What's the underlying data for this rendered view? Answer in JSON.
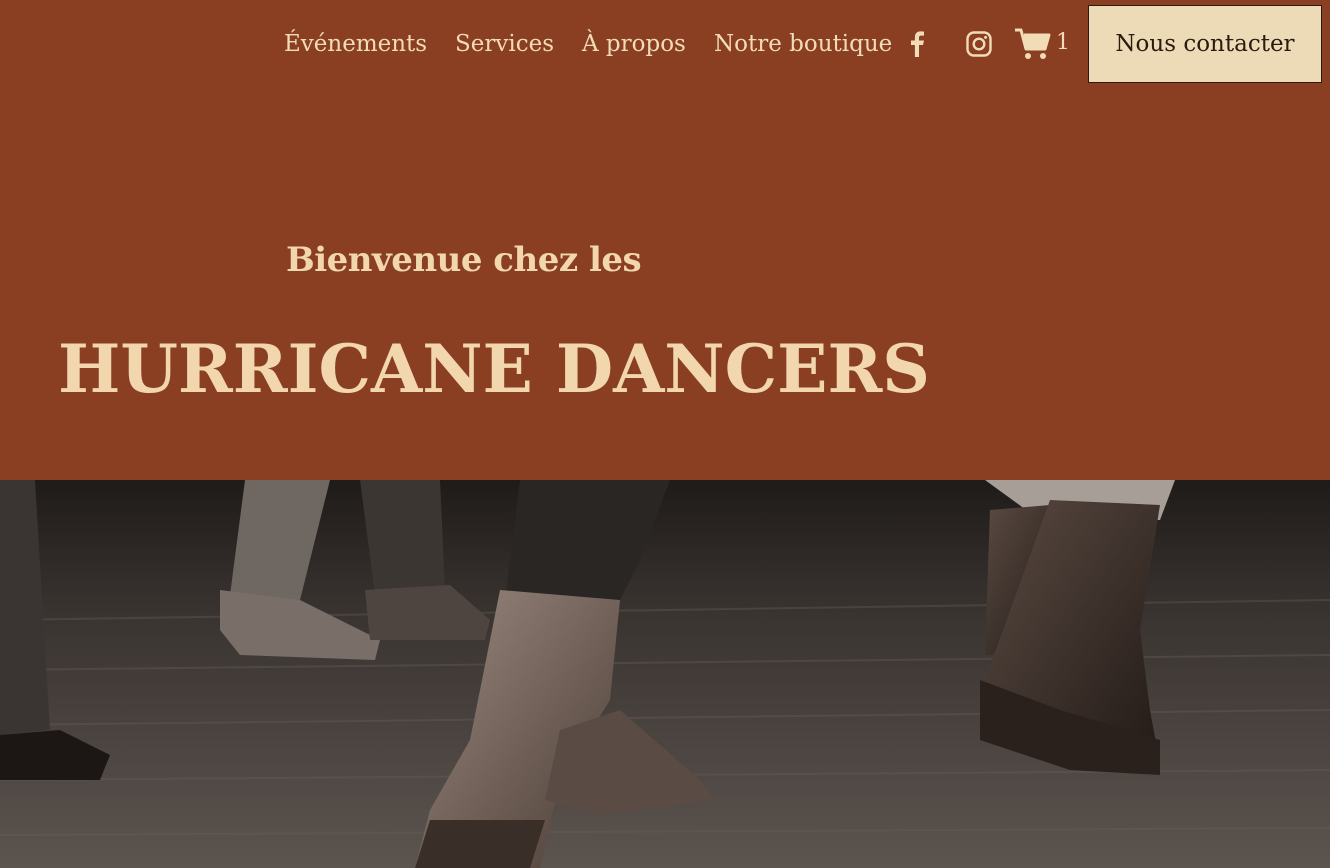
{
  "nav": {
    "items": [
      {
        "label": "Événements"
      },
      {
        "label": "Services"
      },
      {
        "label": "À propos"
      },
      {
        "label": "Notre boutique"
      }
    ],
    "social": [
      {
        "icon": "facebook-icon"
      },
      {
        "icon": "instagram-icon"
      }
    ],
    "cart": {
      "icon": "cart-icon",
      "count": "1"
    },
    "contact_label": "Nous contacter"
  },
  "hero": {
    "welcome": "Bienvenue chez les",
    "title": "HURRICANE DANCERS",
    "image_subject": "cowboy-boots-dancing-photo"
  },
  "colors": {
    "background": "#8b3f22",
    "text_light": "#f2d7ae",
    "button_bg": "#ecdbb6",
    "button_text": "#2a1a10"
  }
}
